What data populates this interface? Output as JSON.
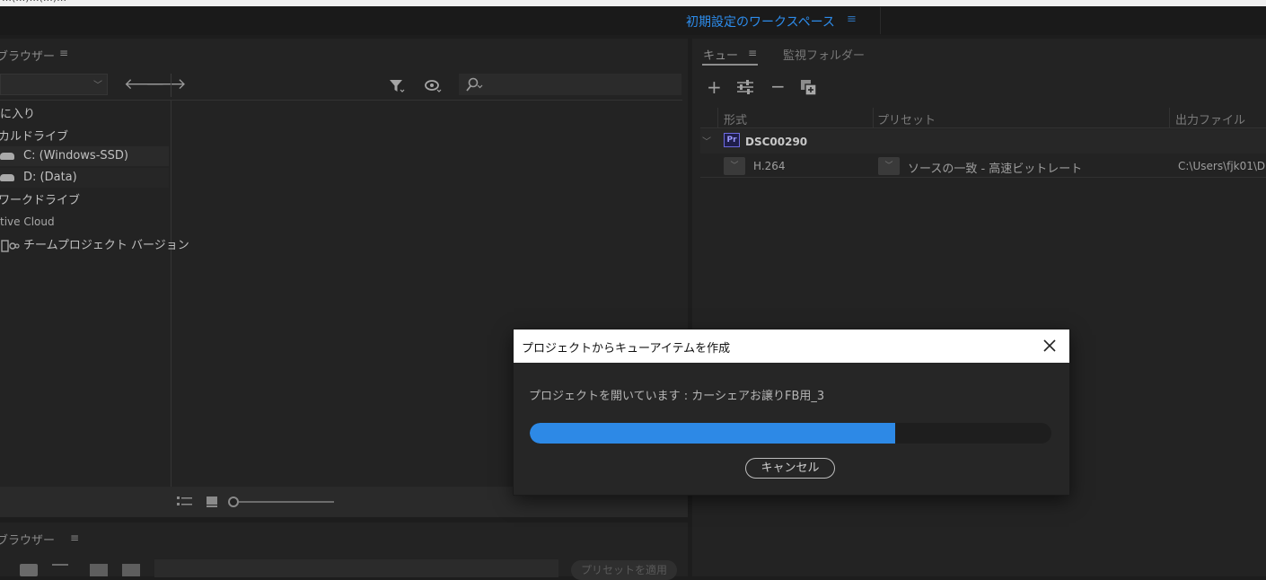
{
  "topbar": {
    "title_fragment": "…(…)…(…)…"
  },
  "workspace": {
    "title": "初期設定のワークスペース",
    "menu_icon": "hamburger-icon"
  },
  "media_browser": {
    "title": "ブラウザー",
    "back_icon": "back-arrow-icon",
    "forward_icon": "forward-arrow-icon",
    "filter_icon": "filter-icon",
    "view_icon": "eye-icon",
    "search_icon": "search-icon",
    "tree": [
      {
        "label": "に入り"
      },
      {
        "label": "カルドライブ"
      },
      {
        "label": "C: (Windows-SSD)"
      },
      {
        "label": "D: (Data)"
      },
      {
        "label": "ワークドライブ"
      },
      {
        "label": "tive Cloud"
      },
      {
        "label": "チームプロジェクト バージョン"
      }
    ]
  },
  "preset_browser": {
    "title": "ブラウザー",
    "apply_label": "プリセットを適用"
  },
  "queue": {
    "tabs": [
      {
        "label": "キュー"
      },
      {
        "label": "監視フォルダー"
      }
    ],
    "toolbar_icons": [
      "add-icon",
      "settings-sliders-icon",
      "remove-icon",
      "duplicate-icon"
    ],
    "columns": [
      {
        "label": "形式"
      },
      {
        "label": "プリセット"
      },
      {
        "label": "出力ファイル"
      }
    ],
    "group": {
      "badge": "Pr",
      "name": "DSC00290"
    },
    "item": {
      "format": "H.264",
      "preset": "ソースの一致 - 高速ビットレート",
      "output": "C:\\Users\\fjk01\\D"
    }
  },
  "dialog": {
    "title": "プロジェクトからキューアイテムを作成",
    "message": "プロジェクトを開いています : カーシェアお譲りFB用_3",
    "progress": 0.7,
    "cancel_label": "キャンセル",
    "close_icon": "close-icon"
  },
  "colors": {
    "accent": "#2d89e6",
    "dialog_bg": "#262626",
    "panel_bg": "#232323"
  }
}
